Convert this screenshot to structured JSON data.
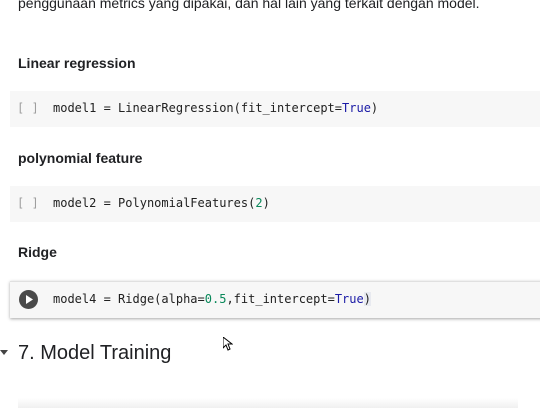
{
  "intro": {
    "text": "penggunaan metrics yang dipakai, dan hal lain yang terkait dengan model."
  },
  "sections": {
    "linear": {
      "heading": "Linear regression",
      "bracket": "[ ]",
      "var": "model1",
      "eq": " = ",
      "call": "LinearRegression(fit_intercept=",
      "arg": "True",
      "end": ")"
    },
    "poly": {
      "heading": "polynomial feature",
      "bracket": "[ ]",
      "var": "model2",
      "eq": " = ",
      "call": "PolynomialFeatures(",
      "arg": "2",
      "end": ")"
    },
    "ridge": {
      "heading": "Ridge",
      "var": "model4",
      "eq": " = ",
      "call_a": "Ridge(",
      "call_b": "alpha=",
      "arg1": "0.5",
      "mid": ",fit_intercept=",
      "arg2": "True",
      "end": ")"
    }
  },
  "training": {
    "title": "7. Model Training"
  },
  "icons": {
    "run": "play-icon",
    "caret": "chevron-down-icon",
    "cursor": "mouse-pointer-icon"
  }
}
